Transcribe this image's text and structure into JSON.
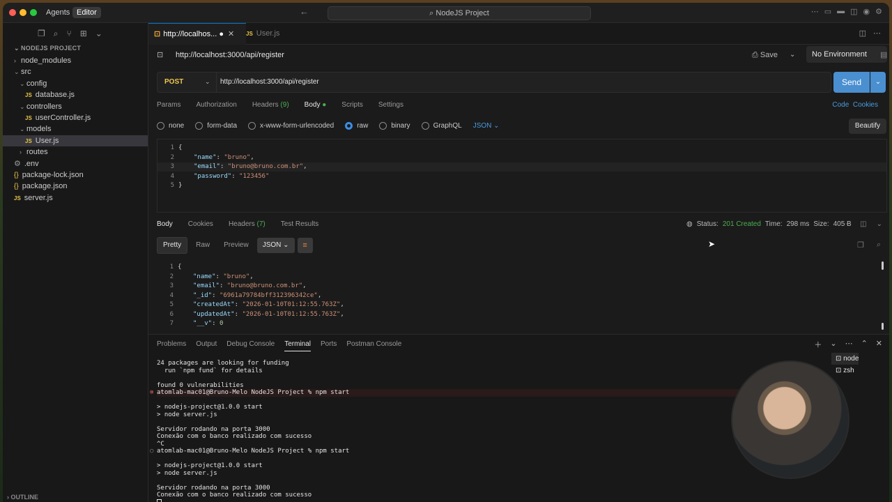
{
  "titlebar": {
    "agents_label": "Agents",
    "editor_label": "Editor",
    "search_text": "NodeJS Project"
  },
  "explorer": {
    "title": "NODEJS PROJECT",
    "items": [
      {
        "label": "node_modules",
        "type": "folder",
        "expanded": false,
        "depth": 0
      },
      {
        "label": "src",
        "type": "folder",
        "expanded": true,
        "depth": 0
      },
      {
        "label": "config",
        "type": "folder",
        "expanded": true,
        "depth": 1
      },
      {
        "label": "database.js",
        "type": "js",
        "depth": 2
      },
      {
        "label": "controllers",
        "type": "folder",
        "expanded": true,
        "depth": 1
      },
      {
        "label": "userController.js",
        "type": "js",
        "depth": 2
      },
      {
        "label": "models",
        "type": "folder",
        "expanded": true,
        "depth": 1
      },
      {
        "label": "User.js",
        "type": "js",
        "depth": 2,
        "selected": true
      },
      {
        "label": "routes",
        "type": "folder",
        "expanded": false,
        "depth": 1
      },
      {
        "label": ".env",
        "type": "env",
        "depth": 0
      },
      {
        "label": "package-lock.json",
        "type": "json",
        "depth": 0
      },
      {
        "label": "package.json",
        "type": "json",
        "depth": 0
      },
      {
        "label": "server.js",
        "type": "js",
        "depth": 0
      }
    ],
    "outline_label": "OUTLINE"
  },
  "tabs": [
    {
      "label": "http://localhos...",
      "active": true
    },
    {
      "label": "User.js",
      "active": false
    }
  ],
  "request": {
    "title": "http://localhost:3000/api/register",
    "save_label": "Save",
    "environment": "No Environment",
    "method": "POST",
    "url": "http://localhost:3000/api/register",
    "send_label": "Send",
    "tabs": {
      "params": "Params",
      "authorization": "Authorization",
      "headers": "Headers",
      "headers_count": "(9)",
      "body": "Body",
      "scripts": "Scripts",
      "settings": "Settings"
    },
    "code_label": "Code",
    "cookies_label": "Cookies",
    "body_types": [
      "none",
      "form-data",
      "x-www-form-urlencoded",
      "raw",
      "binary",
      "GraphQL"
    ],
    "body_format": "JSON",
    "beautify_label": "Beautify",
    "body_lines": [
      {
        "n": "1",
        "text": "{"
      },
      {
        "n": "2",
        "key": "\"name\"",
        "val": "\"bruno\"",
        "tail": ","
      },
      {
        "n": "3",
        "key": "\"email\"",
        "val": "\"bruno@bruno.com.br\"",
        "tail": ","
      },
      {
        "n": "4",
        "key": "\"password\"",
        "val": "\"123456\"",
        "tail": ""
      },
      {
        "n": "5",
        "text": "}"
      }
    ]
  },
  "response": {
    "tabs": {
      "body": "Body",
      "cookies": "Cookies",
      "headers": "Headers",
      "headers_count": "(7)",
      "test_results": "Test Results"
    },
    "status_label": "Status:",
    "status_value": "201 Created",
    "time_label": "Time:",
    "time_value": "298 ms",
    "size_label": "Size:",
    "size_value": "405 B",
    "views": [
      "Pretty",
      "Raw",
      "Preview"
    ],
    "format": "JSON",
    "lines": [
      {
        "n": "1",
        "text": "{"
      },
      {
        "n": "2",
        "key": "\"name\"",
        "val": "\"bruno\"",
        "tail": ","
      },
      {
        "n": "3",
        "key": "\"email\"",
        "val": "\"bruno@bruno.com.br\"",
        "tail": ","
      },
      {
        "n": "4",
        "key": "\"_id\"",
        "val": "\"6961a79784bff312396342ce\"",
        "tail": ","
      },
      {
        "n": "5",
        "key": "\"createdAt\"",
        "val": "\"2026-01-10T01:12:55.763Z\"",
        "tail": ","
      },
      {
        "n": "6",
        "key": "\"updatedAt\"",
        "val": "\"2026-01-10T01:12:55.763Z\"",
        "tail": ","
      },
      {
        "n": "7",
        "key": "\"__v\"",
        "num": "0",
        "tail": ""
      }
    ]
  },
  "panel": {
    "tabs": [
      "Problems",
      "Output",
      "Debug Console",
      "Terminal",
      "Ports",
      "Postman Console"
    ],
    "active_tab": "Terminal",
    "terminal_lines": [
      {
        "text": "24 packages are looking for funding",
        "kind": "plain"
      },
      {
        "text": "  run `npm fund` for details",
        "kind": "plain"
      },
      {
        "text": "",
        "kind": "plain"
      },
      {
        "text": "found 0 vulnerabilities",
        "kind": "plain"
      },
      {
        "text": "atomlab-mac01@Bruno-Melo NodeJS Project % npm start",
        "kind": "error-prompt"
      },
      {
        "text": "",
        "kind": "plain"
      },
      {
        "text": "> nodejs-project@1.0.0 start",
        "kind": "plain"
      },
      {
        "text": "> node server.js",
        "kind": "plain"
      },
      {
        "text": "",
        "kind": "plain"
      },
      {
        "text": "Servidor rodando na porta 3000",
        "kind": "plain"
      },
      {
        "text": "Conexão com o banco realizado com sucesso",
        "kind": "plain"
      },
      {
        "text": "^C",
        "kind": "plain"
      },
      {
        "text": "atomlab-mac01@Bruno-Melo NodeJS Project % npm start",
        "kind": "prompt"
      },
      {
        "text": "",
        "kind": "plain"
      },
      {
        "text": "> nodejs-project@1.0.0 start",
        "kind": "plain"
      },
      {
        "text": "> node server.js",
        "kind": "plain"
      },
      {
        "text": "",
        "kind": "plain"
      },
      {
        "text": "Servidor rodando na porta 3000",
        "kind": "plain"
      },
      {
        "text": "Conexão com o banco realizado com sucesso",
        "kind": "plain"
      }
    ],
    "processes": [
      "node",
      "zsh"
    ]
  },
  "colors": {
    "accent": "#4a8fd0",
    "status_ok": "#4caf50",
    "method": "#f0c850"
  }
}
